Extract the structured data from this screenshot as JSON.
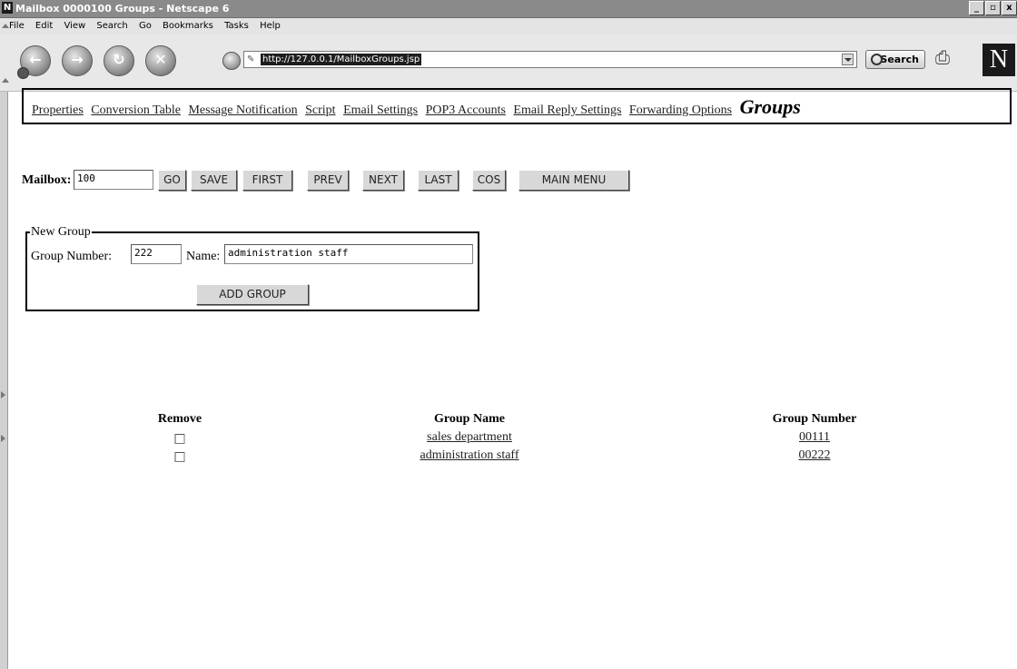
{
  "window": {
    "title": "Mailbox 0000100 Groups - Netscape 6",
    "logo_glyph": "N",
    "controls": [
      "_",
      "▫",
      "x"
    ]
  },
  "menubar": {
    "items": [
      "File",
      "Edit",
      "View",
      "Search",
      "Go",
      "Bookmarks",
      "Tasks",
      "Help"
    ]
  },
  "navbar": {
    "url": "http://127.0.0.1/MailboxGroups.jsp",
    "search_label": "Search",
    "logo": "N"
  },
  "tabs": {
    "items": [
      "Properties",
      "Conversion Table",
      "Message Notification",
      "Script",
      "Email Settings",
      "POP3 Accounts",
      "Email Reply Settings",
      "Forwarding Options"
    ],
    "current": "Groups"
  },
  "mailbox": {
    "label": "Mailbox:",
    "value": "100",
    "buttons": [
      "GO",
      "SAVE",
      "FIRST",
      "PREV",
      "NEXT",
      "LAST",
      "COS",
      "MAIN MENU"
    ]
  },
  "new_group": {
    "legend": "New Group",
    "number_label": "Group Number:",
    "number_value": "222",
    "name_label": "Name:",
    "name_value": "administration staff",
    "add_button": "ADD GROUP"
  },
  "groups_table": {
    "headers": [
      "Remove",
      "Group Name",
      "Group Number"
    ],
    "rows": [
      {
        "name": "sales department",
        "number": "00111",
        "checked": false
      },
      {
        "name": "administration staff",
        "number": "00222",
        "checked": false
      }
    ]
  }
}
